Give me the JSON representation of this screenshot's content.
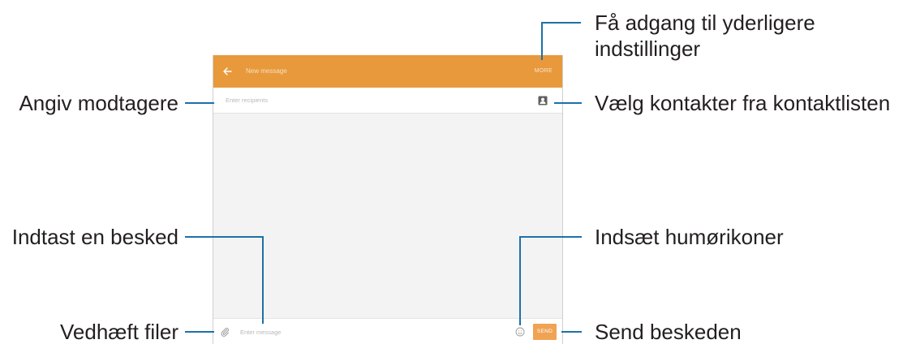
{
  "screen": {
    "header": {
      "title": "New message",
      "more_label": "MORE"
    },
    "recipients": {
      "placeholder": "Enter recipients"
    },
    "composer": {
      "placeholder": "Enter message",
      "send_label": "SEND"
    }
  },
  "icons": {
    "back": "arrow-left-icon",
    "contacts": "contact-book-icon",
    "attach": "paperclip-icon",
    "emoticon": "smiley-icon"
  },
  "callouts": {
    "more_settings": {
      "line_1": "Få adgang til yderligere",
      "line_2": "indstillinger"
    },
    "recipients": "Angiv modtagere",
    "contacts": "Vælg kontakter fra kontaktlisten",
    "message": "Indtast en besked",
    "emoticons": "Indsæt humørikoner",
    "attach": "Vedhæft filer",
    "send": "Send beskeden"
  },
  "colors": {
    "header": "#E8993C",
    "send_button": "#F0A352",
    "callout_line": "#1E70A8",
    "label_text": "#231F20",
    "screen_background": "#F3F3F3"
  }
}
